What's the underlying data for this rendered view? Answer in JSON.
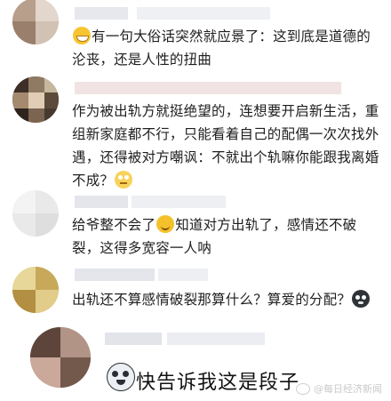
{
  "comments": [
    {
      "text_before": "",
      "emoji": "grin-sweat-emoji",
      "text": "有一句大俗话突然就应景了：这到底是道德的沦丧，还是人性的扭曲",
      "text_after": ""
    },
    {
      "text_before": "作为被出轨方就挺绝望的，连想要开启新生活，重组新家庭都不行，只能看着自己的配偶一次次找外遇，还得被对方嘲讽：不就出个轨嘛你能跟我离婚不成？",
      "emoji": "eye-roll-emoji"
    },
    {
      "text_before": "给爷整不会了",
      "emoji": "smile-emoji",
      "text_after": "知道对方出轨了，感情还不破裂，这得多宽容一人呐"
    },
    {
      "text_before": "出轨还不算感情破裂那算什么？算爱的分配？",
      "emoji": "dog-face-emoji"
    }
  ],
  "highlight": {
    "emoji": "dog-emoji",
    "text": "快告诉我这是段子"
  },
  "watermark": {
    "text": "@每日经济新闻",
    "icon": "weibo-icon"
  },
  "colors": {
    "text": "#1e1e1e",
    "name_placeholder": "#e6e9ef",
    "name_accent": "#f2d9d9"
  }
}
